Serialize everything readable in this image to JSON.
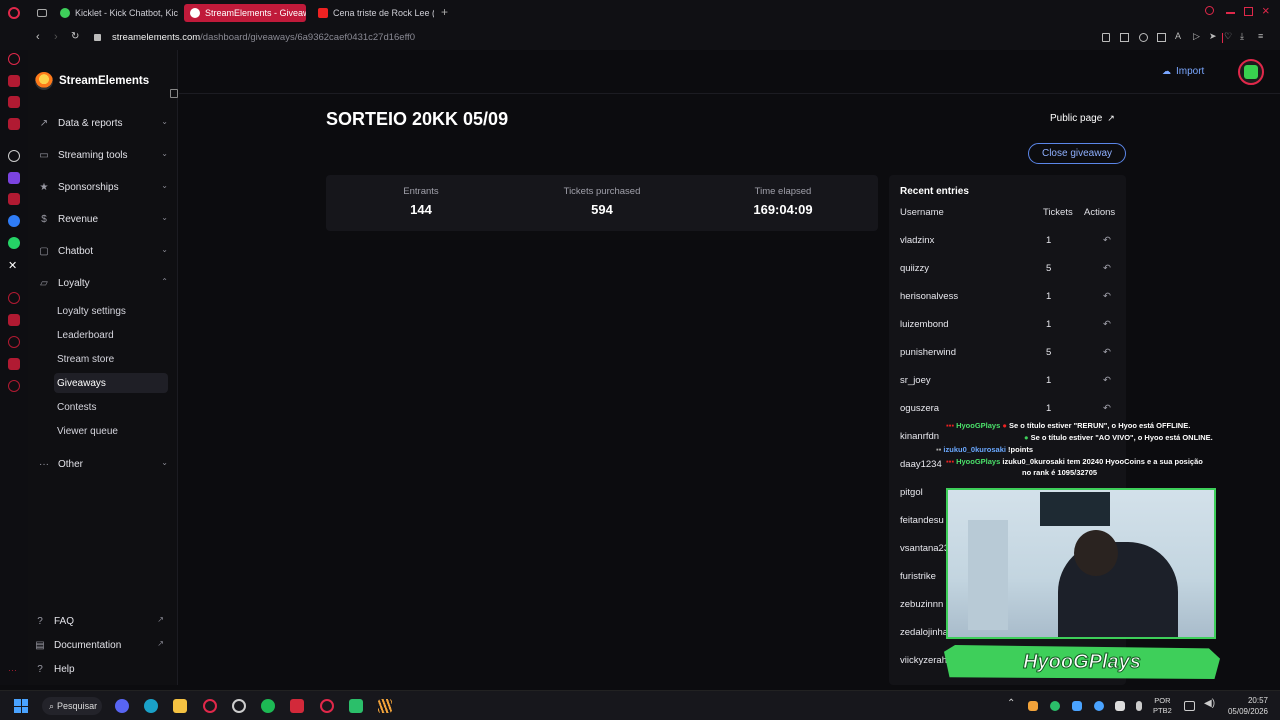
{
  "browser": {
    "tabs": [
      {
        "label": "Kicklet - Kick Chatbot, Kick"
      },
      {
        "label": "StreamElements - Giveaw"
      },
      {
        "label": "Cena triste de Rock Lee (N"
      }
    ],
    "url_host": "streamelements.com",
    "url_path": "/dashboard/giveaways/6a9362caef0431c27d16eff0"
  },
  "sidebar": {
    "brand": "StreamElements",
    "items": [
      {
        "label": "Data & reports"
      },
      {
        "label": "Streaming tools"
      },
      {
        "label": "Sponsorships"
      },
      {
        "label": "Revenue"
      },
      {
        "label": "Chatbot"
      },
      {
        "label": "Loyalty"
      }
    ],
    "loyalty_sub": [
      {
        "label": "Loyalty settings"
      },
      {
        "label": "Leaderboard"
      },
      {
        "label": "Stream store"
      },
      {
        "label": "Giveaways"
      },
      {
        "label": "Contests"
      },
      {
        "label": "Viewer queue"
      }
    ],
    "other": "Other",
    "footer": [
      {
        "label": "FAQ"
      },
      {
        "label": "Documentation"
      },
      {
        "label": "Help"
      }
    ]
  },
  "header": {
    "import": "Import"
  },
  "giveaway": {
    "title": "SORTEIO 20KK 05/09",
    "public_page": "Public page",
    "close_button": "Close giveaway",
    "stats": {
      "entrants_label": "Entrants",
      "entrants_value": "144",
      "tickets_label": "Tickets purchased",
      "tickets_value": "594",
      "elapsed_label": "Time elapsed",
      "elapsed_value": "169:04:09"
    },
    "recent": {
      "title": "Recent entries",
      "col_username": "Username",
      "col_tickets": "Tickets",
      "col_actions": "Actions",
      "rows": [
        {
          "user": "vladzinx",
          "tickets": "1"
        },
        {
          "user": "quiizzy",
          "tickets": "5"
        },
        {
          "user": "herisonalvess",
          "tickets": "1"
        },
        {
          "user": "luizembond",
          "tickets": "1"
        },
        {
          "user": "punisherwind",
          "tickets": "5"
        },
        {
          "user": "sr_joey",
          "tickets": "1"
        },
        {
          "user": "oguszera",
          "tickets": "1"
        },
        {
          "user": "kinanrfdn",
          "tickets": ""
        },
        {
          "user": "daay1234",
          "tickets": ""
        },
        {
          "user": "pitgol",
          "tickets": ""
        },
        {
          "user": "feitandesu",
          "tickets": ""
        },
        {
          "user": "vsantana23",
          "tickets": ""
        },
        {
          "user": "furistrike",
          "tickets": ""
        },
        {
          "user": "zebuzinnn",
          "tickets": ""
        },
        {
          "user": "zedalojinha",
          "tickets": ""
        },
        {
          "user": "viickyzerah",
          "tickets": ""
        }
      ]
    }
  },
  "overlay": {
    "chat": [
      {
        "name": "HyooGPlays",
        "text": "Se o título estiver \"RERUN\", o Hyoo está OFFLINE."
      },
      {
        "name": "",
        "text": "Se o título estiver \"AO VIVO\", o Hyoo está ONLINE."
      },
      {
        "name": "izuku0_0kurosaki",
        "text": "!points"
      },
      {
        "name": "HyooGPlays",
        "text": "izuku0_0kurosaki tem 20240 HyooCoins e a sua posição"
      },
      {
        "name": "",
        "text": "no rank é 1095/32705"
      }
    ],
    "banner": "HyooGPlays"
  },
  "taskbar": {
    "search": "Pesquisar",
    "lang": "POR",
    "layout": "PTB2",
    "time": "20:57",
    "date": "05/09/2026"
  }
}
